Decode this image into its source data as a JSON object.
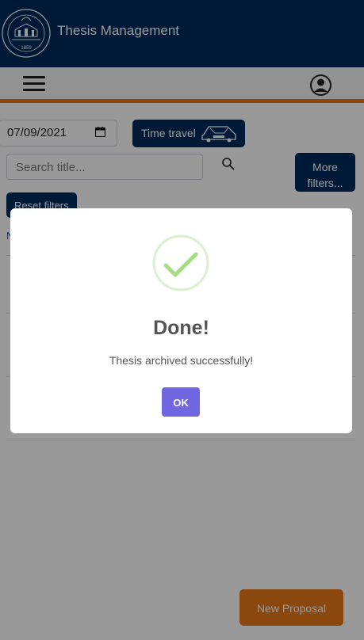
{
  "header": {
    "title": "Thesis Management",
    "logo_year": "1859"
  },
  "filters": {
    "date_value": "07/09/2021",
    "time_travel_label": "Time travel",
    "search_placeholder": "Search title...",
    "more_filters_line1": "More",
    "more_filters_line2": "filters...",
    "reset_label": "Reset filters",
    "list_fragment": "N"
  },
  "footer": {
    "new_proposal_label": "New Proposal"
  },
  "dialog": {
    "title": "Done!",
    "message": "Thesis archived successfully!",
    "ok_label": "OK"
  },
  "colors": {
    "brand_navy": "#002b5c",
    "accent_orange": "#e6791a",
    "success_green": "#a5dc86",
    "ok_purple": "#7066e0"
  }
}
